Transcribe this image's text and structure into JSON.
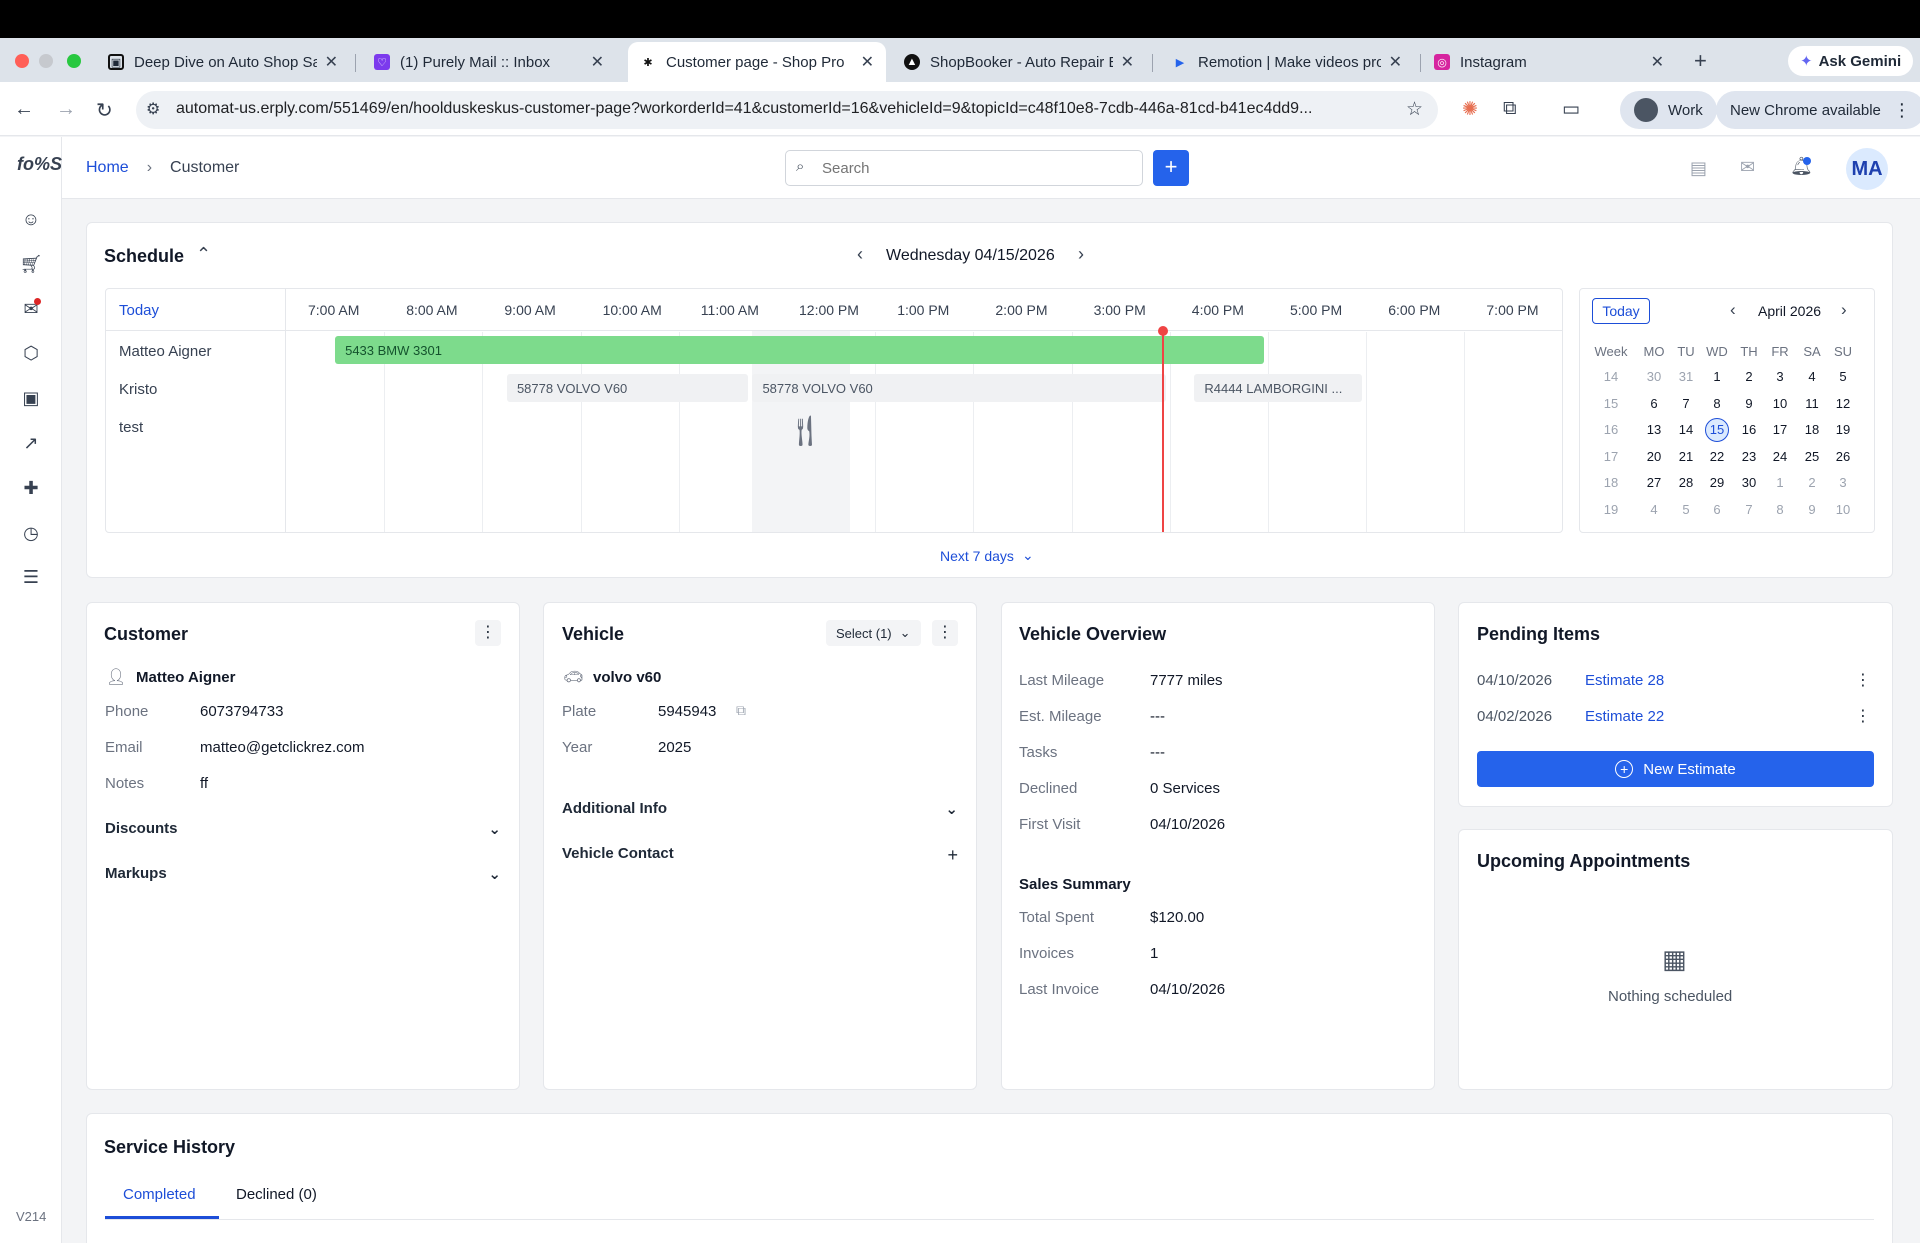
{
  "browser": {
    "tabs": [
      {
        "title": "Deep Dive on Auto Shop Saa",
        "fav": "▣"
      },
      {
        "title": "(1) Purely Mail :: Inbox",
        "fav": "♡"
      },
      {
        "title": "Customer page - Shop Pro",
        "fav": "✱"
      },
      {
        "title": "ShopBooker - Auto Repair Bo",
        "fav": "▲"
      },
      {
        "title": "Remotion | Make videos prog",
        "fav": "▶"
      },
      {
        "title": "Instagram",
        "fav": "◎"
      }
    ],
    "new_tab": "+",
    "gemini_label": "Ask Gemini",
    "url": "automat-us.erply.com/551469/en/hoolduskeskus-customer-page?workorderId=41&customerId=16&vehicleId=9&topicId=c48f10e8-7cdb-446a-81cd-b41ec4dd9...",
    "profile_label": "Work",
    "update_label": "New Chrome available"
  },
  "app": {
    "logo": "fo%S",
    "version": "V214",
    "breadcrumb": {
      "home": "Home",
      "sep": "›",
      "current": "Customer"
    },
    "search": {
      "placeholder": "Search"
    },
    "add_label": "+",
    "avatar": "MA"
  },
  "schedule": {
    "title": "Schedule",
    "date": "Wednesday 04/15/2026",
    "today_label": "Today",
    "hours": [
      "7:00 AM",
      "8:00 AM",
      "9:00 AM",
      "10:00 AM",
      "11:00 AM",
      "12:00 PM",
      "1:00 PM",
      "2:00 PM",
      "3:00 PM",
      "4:00 PM",
      "5:00 PM",
      "6:00 PM",
      "7:00 PM"
    ],
    "resources": [
      "Matteo Aigner",
      "Kristo",
      "test"
    ],
    "bookings": [
      {
        "label": "5433 BMW 3301",
        "start": "7:30 AM",
        "end": "5:00 PM",
        "row": 0,
        "color": "#7ddb8c"
      },
      {
        "label": "58778 VOLVO V60",
        "start": "9:15 AM",
        "end": "11:45 AM",
        "row": 1,
        "color": "#f0f1f3"
      },
      {
        "label": "58778 VOLVO V60",
        "start": "11:45 AM",
        "end": "4:00 PM",
        "row": 1,
        "color": "#f0f1f3"
      },
      {
        "label": "R4444 LAMBORGINI ...",
        "start": "4:15 PM",
        "end": "6:00 PM",
        "row": 1,
        "color": "#f0f1f3"
      }
    ],
    "now_time": "3:56 PM",
    "lunch_icon": "fork-knife-icon",
    "next_days": "Next 7 days",
    "mini_cal": {
      "today_label": "Today",
      "month": "April 2026",
      "headers": [
        "Week",
        "MO",
        "TU",
        "WD",
        "TH",
        "FR",
        "SA",
        "SU"
      ],
      "weeks": [
        [
          "14",
          "30",
          "31",
          "1",
          "2",
          "3",
          "4",
          "5"
        ],
        [
          "15",
          "6",
          "7",
          "8",
          "9",
          "10",
          "11",
          "12"
        ],
        [
          "16",
          "13",
          "14",
          "15",
          "16",
          "17",
          "18",
          "19"
        ],
        [
          "17",
          "20",
          "21",
          "22",
          "23",
          "24",
          "25",
          "26"
        ],
        [
          "18",
          "27",
          "28",
          "29",
          "30",
          "1",
          "2",
          "3"
        ],
        [
          "19",
          "4",
          "5",
          "6",
          "7",
          "8",
          "9",
          "10"
        ]
      ],
      "selected": "15"
    }
  },
  "customer": {
    "title": "Customer",
    "name": "Matteo Aigner",
    "fields": [
      {
        "label": "Phone",
        "value": "6073794733"
      },
      {
        "label": "Email",
        "value": "matteo@getclickrez.com"
      },
      {
        "label": "Notes",
        "value": "ff"
      }
    ],
    "discounts": "Discounts",
    "markups": "Markups"
  },
  "vehicle": {
    "title": "Vehicle",
    "select_label": "Select (1)",
    "name": "volvo v60",
    "fields": [
      {
        "label": "Plate",
        "value": "5945943"
      },
      {
        "label": "Year",
        "value": "2025"
      }
    ],
    "additional_info": "Additional Info",
    "vehicle_contact": "Vehicle Contact"
  },
  "overview": {
    "title": "Vehicle Overview",
    "fields": [
      {
        "label": "Last Mileage",
        "value": "7777 miles"
      },
      {
        "label": "Est. Mileage",
        "value": "---"
      },
      {
        "label": "Tasks",
        "value": "---"
      },
      {
        "label": "Declined",
        "value": "0 Services"
      },
      {
        "label": "First Visit",
        "value": "04/10/2026"
      }
    ],
    "sales_title": "Sales Summary",
    "sales": [
      {
        "label": "Total Spent",
        "value": "$120.00"
      },
      {
        "label": "Invoices",
        "value": "1"
      },
      {
        "label": "Last Invoice",
        "value": "04/10/2026"
      }
    ]
  },
  "pending": {
    "title": "Pending Items",
    "items": [
      {
        "date": "04/10/2026",
        "label": "Estimate 28"
      },
      {
        "date": "04/02/2026",
        "label": "Estimate 22"
      }
    ],
    "new_estimate": "New Estimate"
  },
  "upcoming": {
    "title": "Upcoming Appointments",
    "empty": "Nothing scheduled"
  },
  "history": {
    "title": "Service History",
    "tabs": [
      "Completed",
      "Declined (0)"
    ]
  }
}
